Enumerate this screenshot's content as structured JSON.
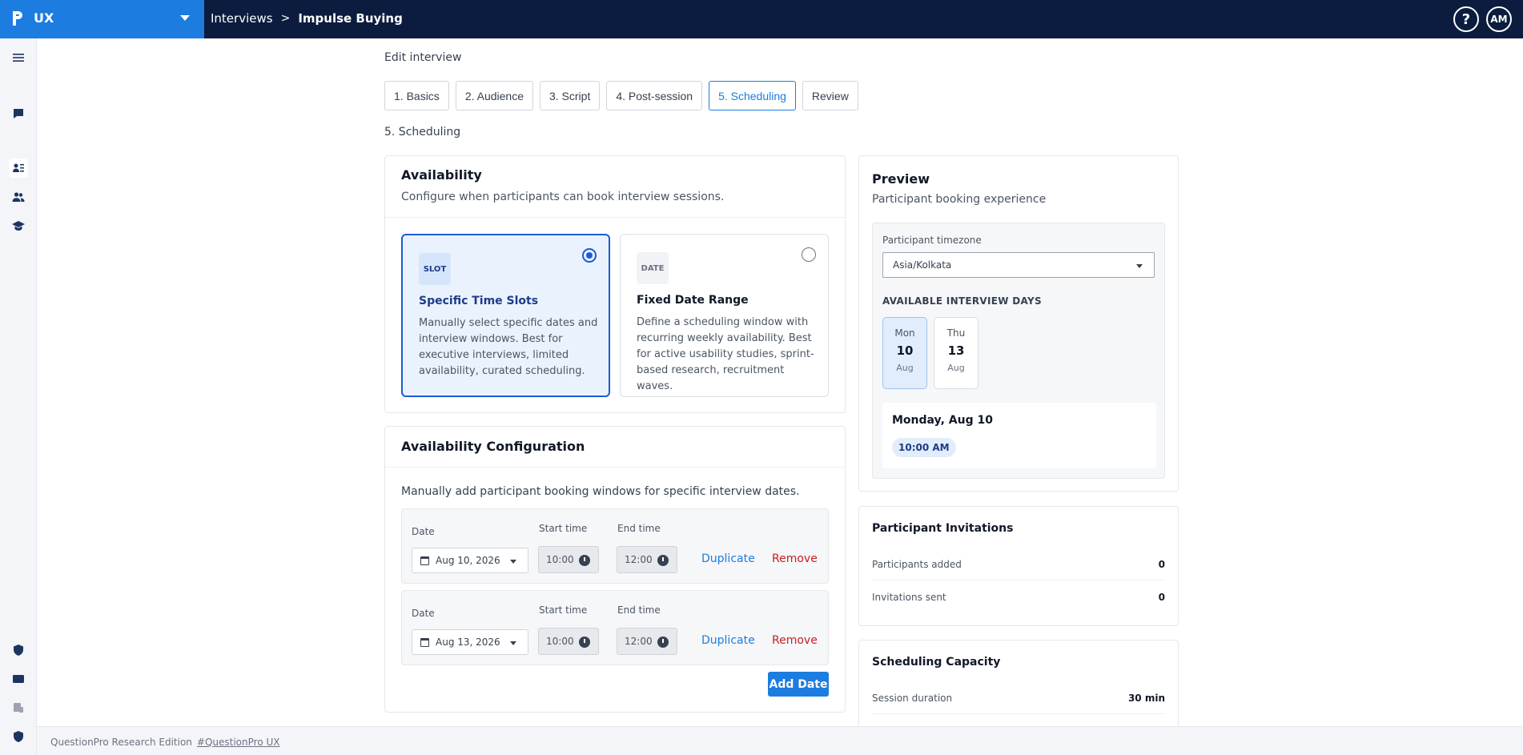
{
  "app": {
    "name": "UX"
  },
  "breadcrumb": {
    "parent": "Interviews",
    "separator": ">",
    "current": "Impulse Buying"
  },
  "header": {
    "help_label": "?",
    "avatar_initials": "AM"
  },
  "page": {
    "heading": "Edit interview",
    "section_label": "5. Scheduling"
  },
  "tabs": [
    {
      "label": "1. Basics",
      "active": false
    },
    {
      "label": "2. Audience",
      "active": false
    },
    {
      "label": "3. Script",
      "active": false
    },
    {
      "label": "4. Post-session",
      "active": false
    },
    {
      "label": "5. Scheduling",
      "active": true
    },
    {
      "label": "Review",
      "active": false
    }
  ],
  "availability": {
    "title": "Availability",
    "subtitle": "Configure when participants can book interview sessions.",
    "options": [
      {
        "chip": "SLOT",
        "title": "Specific Time Slots",
        "description": "Manually select specific dates and interview windows. Best for executive interviews, limited availability, curated scheduling.",
        "selected": true
      },
      {
        "chip": "DATE",
        "title": "Fixed Date Range",
        "description": "Define a scheduling window with recurring weekly availability. Best for active usability studies, sprint-based research, recruitment waves.",
        "selected": false
      }
    ]
  },
  "config": {
    "title": "Availability Configuration",
    "intro": "Manually add participant booking windows for specific interview dates.",
    "labels": {
      "date": "Date",
      "start": "Start time",
      "end": "End time",
      "duplicate": "Duplicate",
      "remove": "Remove"
    },
    "rows": [
      {
        "date": "Aug 10, 2026",
        "start": "10:00",
        "end": "12:00"
      },
      {
        "date": "Aug 13, 2026",
        "start": "10:00",
        "end": "12:00"
      }
    ],
    "add_label": "Add Date"
  },
  "preview": {
    "title": "Preview",
    "subtitle": "Participant booking experience",
    "timezone_label": "Participant timezone",
    "timezone_value": "Asia/Kolkata",
    "available_label": "AVAILABLE INTERVIEW DAYS",
    "days": [
      {
        "weekday": "Mon",
        "day": "10",
        "month": "Aug",
        "selected": true
      },
      {
        "weekday": "Thu",
        "day": "13",
        "month": "Aug",
        "selected": false
      }
    ],
    "selected_day": "Monday, Aug 10",
    "time_chip": "10:00 AM"
  },
  "invitations": {
    "title": "Participant Invitations",
    "stats": [
      {
        "label": "Participants added",
        "value": "0"
      },
      {
        "label": "Invitations sent",
        "value": "0"
      }
    ]
  },
  "capacity": {
    "title": "Scheduling Capacity",
    "stats": [
      {
        "label": "Session duration",
        "value": "30 min"
      }
    ]
  },
  "footer": {
    "text": "QuestionPro Research Edition",
    "link": "#QuestionPro UX"
  },
  "colors": {
    "accent": "#1c7ce0",
    "topbar": "#0b1c3f",
    "danger": "#c81e1e"
  }
}
